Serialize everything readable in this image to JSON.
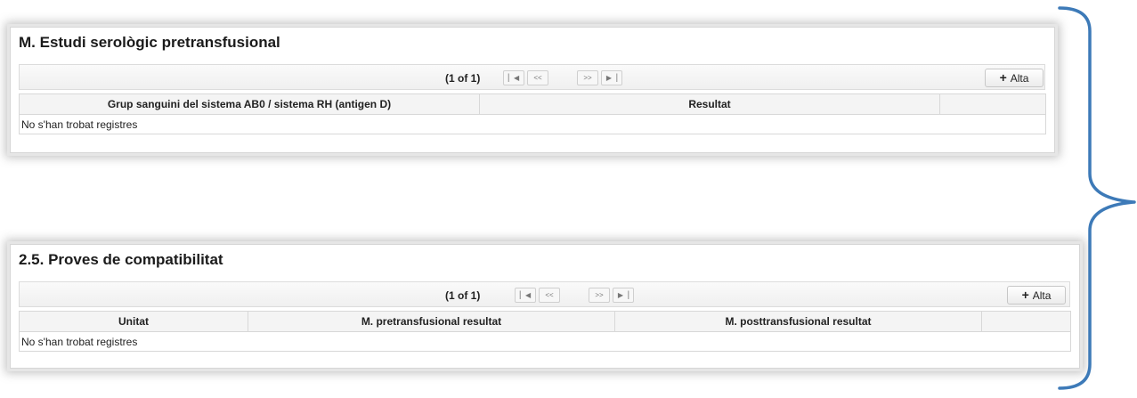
{
  "section1": {
    "title": "M. Estudi serològic pretransfusional",
    "pager": {
      "count": "(1 of 1)",
      "first": "⏮",
      "prev": "<<",
      "next": ">>",
      "last": "⏭"
    },
    "add_label": "Alta",
    "columns": [
      "Grup sanguini del sistema AB0 / sistema RH (antigen D)",
      "Resultat",
      ""
    ],
    "empty_message": "No s'han trobat registres"
  },
  "section2": {
    "title": "2.5. Proves de compatibilitat",
    "pager": {
      "count": "(1 of 1)",
      "first": "⏮",
      "prev": "<<",
      "next": ">>",
      "last": "⏭"
    },
    "add_label": "Alta",
    "columns": [
      "Unitat",
      "M. pretransfusional resultat",
      "M. posttransfusional resultat",
      ""
    ],
    "empty_message": "No s'han trobat registres"
  },
  "icons": {
    "add": "plus-icon",
    "first": "first-page-icon",
    "prev": "prev-page-icon",
    "next": "next-page-icon",
    "last": "last-page-icon",
    "bracket": "curly-bracket-icon"
  },
  "colors": {
    "bracket": "#3d7ab8",
    "header_bg": "#f4f4f4",
    "border": "#d8d8d8"
  }
}
